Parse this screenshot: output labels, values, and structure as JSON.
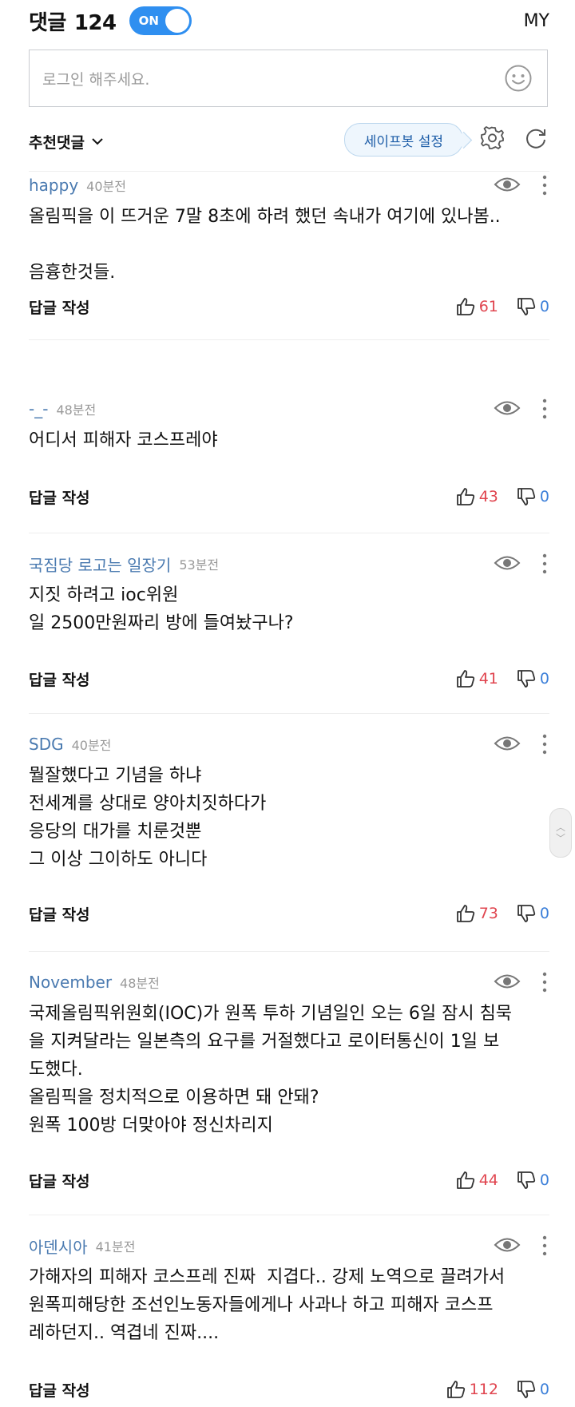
{
  "header": {
    "title": "댓글",
    "count": "124",
    "toggle_label": "ON",
    "my_label": "MY"
  },
  "input": {
    "placeholder": "로그인 해주세요."
  },
  "sort": {
    "label": "추천댓글",
    "safebot_label": "세이프봇 설정"
  },
  "comments": [
    {
      "author": "happy",
      "time": "40분전",
      "lines": [
        "올림픽을 이 뜨거운 7말 8초에 하려 했던 속내가 여기에 있나봄..",
        "",
        "음흉한것들."
      ],
      "reply_label": "답글 작성",
      "likes": "61",
      "dislikes": "0"
    },
    {
      "author": "-_-",
      "time": "48분전",
      "lines": [
        "어디서 피해자 코스프레야"
      ],
      "reply_label": "답글 작성",
      "likes": "43",
      "dislikes": "0"
    },
    {
      "author": "국짐당 로고는 일장기",
      "time": "53분전",
      "lines": [
        "지짓 하려고 ioc위원",
        "일 2500만원짜리 방에 들여놨구나?"
      ],
      "reply_label": "답글 작성",
      "likes": "41",
      "dislikes": "0"
    },
    {
      "author": "SDG",
      "time": "40분전",
      "lines": [
        "뭘잘했다고 기념을 하냐",
        "전세계를 상대로 양아치짓하다가",
        "응당의 대가를 치룬것뿐",
        "그 이상 그이하도 아니다"
      ],
      "reply_label": "답글 작성",
      "likes": "73",
      "dislikes": "0"
    },
    {
      "author": "November",
      "time": "48분전",
      "lines": [
        "국제올림픽위원회(IOC)가 원폭 투하 기념일인 오는 6일 잠시 침묵",
        "을 지켜달라는 일본측의 요구를 거절했다고 로이터통신이 1일 보",
        "도했다.",
        "올림픽을 정치적으로 이용하면 돼 안돼?",
        "원폭 100방 더맞아야 정신차리지"
      ],
      "reply_label": "답글 작성",
      "likes": "44",
      "dislikes": "0"
    },
    {
      "author": "아덴시아",
      "time": "41분전",
      "lines": [
        "가해자의 피해자 코스프레 진짜  지겹다.. 강제 노역으로 끌려가서",
        "원폭피해당한 조선인노동자들에게나 사과나 하고 피해자 코스프",
        "레하던지.. 역겹네 진짜...."
      ],
      "reply_label": "답글 작성",
      "likes": "112",
      "dislikes": "0"
    }
  ]
}
